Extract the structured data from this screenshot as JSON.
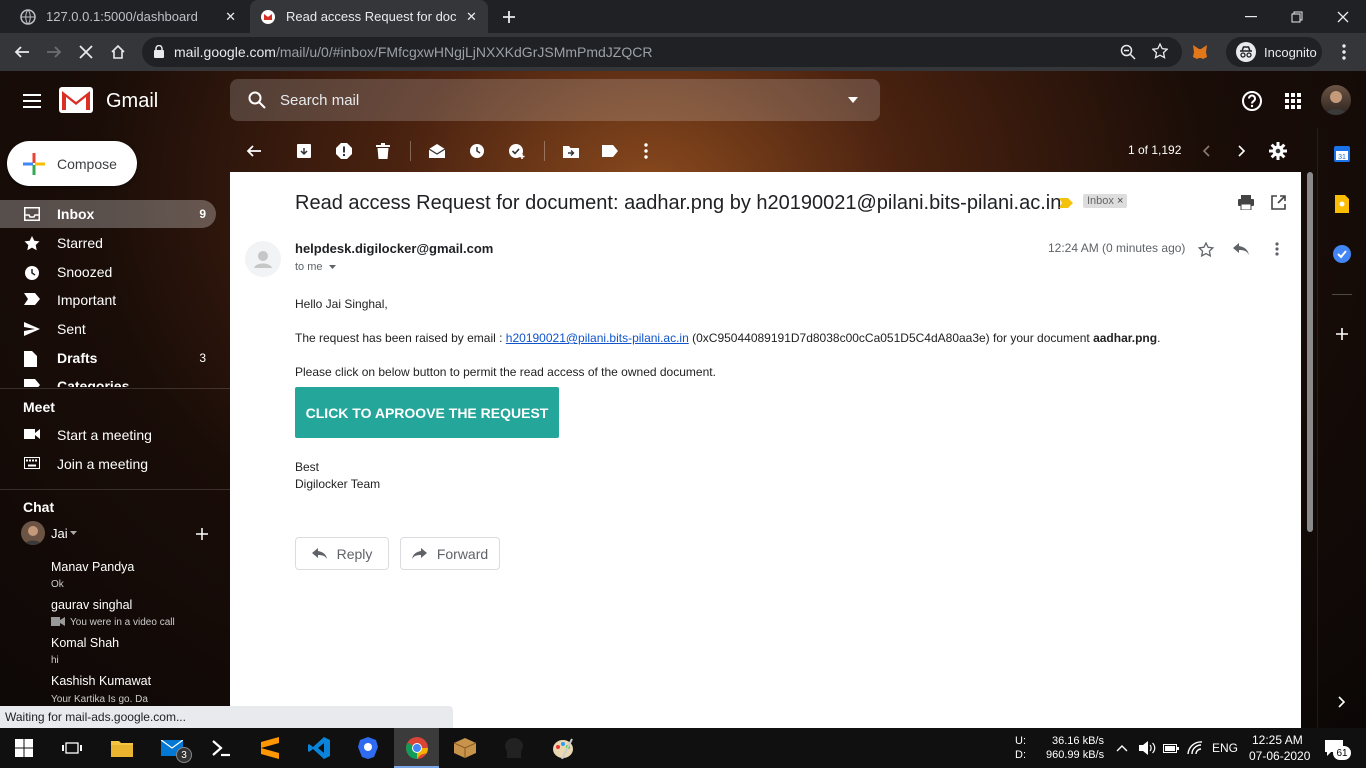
{
  "browser": {
    "tabs": [
      {
        "title": "127.0.0.1:5000/dashboard"
      },
      {
        "title": "Read access Request for docume"
      }
    ],
    "url_host": "mail.google.com",
    "url_path": "/mail/u/0/#inbox/FMfcgxwHNgjLjNXXKdGrJSMmPmdJZQCR",
    "profile_label": "Incognito",
    "status_text": "Waiting for mail-ads.google.com..."
  },
  "gmail": {
    "logo": "Gmail",
    "search_placeholder": "Search mail",
    "compose_label": "Compose",
    "nav": [
      {
        "label": "Inbox",
        "count": "9",
        "icon": "inbox-icon"
      },
      {
        "label": "Starred",
        "count": "",
        "icon": "star-icon"
      },
      {
        "label": "Snoozed",
        "count": "",
        "icon": "clock-icon"
      },
      {
        "label": "Important",
        "count": "",
        "icon": "important-icon"
      },
      {
        "label": "Sent",
        "count": "",
        "icon": "send-icon"
      },
      {
        "label": "Drafts",
        "count": "3",
        "icon": "draft-icon"
      },
      {
        "label": "Categories",
        "count": "",
        "icon": "label-icon"
      }
    ],
    "meet": {
      "title": "Meet",
      "start": "Start a meeting",
      "join": "Join a meeting"
    },
    "chat": {
      "title": "Chat",
      "self": "Jai",
      "contacts": [
        {
          "name": "Manav Pandya",
          "status": "Ok"
        },
        {
          "name": "gaurav singhal",
          "status": "You were in a video call"
        },
        {
          "name": "Komal Shah",
          "status": "hi"
        },
        {
          "name": "Kashish Kumawat",
          "status": "Your Kartika Is go. Da"
        }
      ]
    },
    "pagination": "1 of 1,192"
  },
  "email": {
    "subject": "Read access Request for document: aadhar.png by h20190021@pilani.bits-pilani.ac.in",
    "label_tag": "Inbox",
    "sender": "helpdesk.digilocker@gmail.com",
    "to": "to me",
    "time": "12:24 AM (0 minutes ago)",
    "greeting": "Hello Jai Singhal,",
    "line1_prefix": "The request has been raised by email : ",
    "line1_link": "h20190021@pilani.bits-pilani.ac.in",
    "line1_mid": " (0xC95044089191D7d8038c00cCa051D5C4dA80aa3e) for your document ",
    "line1_doc": "aadhar.png",
    "line1_end": ".",
    "line2": "Please click on below button to permit the read access of the owned document.",
    "cta": "CLICK TO APROOVE THE REQUEST",
    "signoff1": "Best",
    "signoff2": "Digilocker Team",
    "reply": "Reply",
    "forward": "Forward"
  },
  "taskbar": {
    "mail_badge": "3",
    "net_up_label": "U:",
    "net_up": "36.16 kB/s",
    "net_down_label": "D:",
    "net_down": "960.99 kB/s",
    "lang": "ENG",
    "time": "12:25 AM",
    "date": "07-06-2020",
    "notif": "61"
  },
  "colors": {
    "cta": "#24a69a",
    "link": "#1155cc",
    "chrome_dark": "#202124"
  }
}
